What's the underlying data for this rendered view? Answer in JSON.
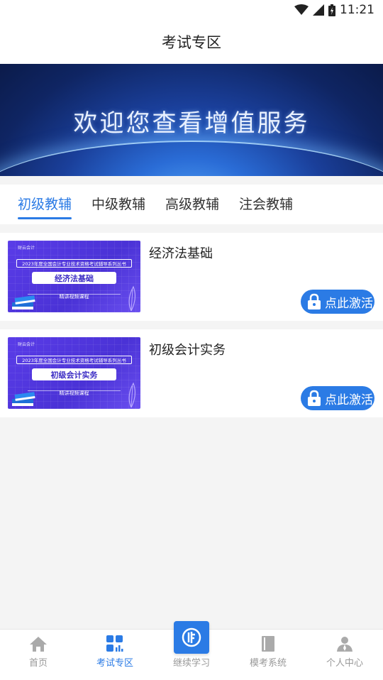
{
  "status": {
    "time": "11:21"
  },
  "header": {
    "title": "考试专区"
  },
  "banner": {
    "text": "欢迎您查看增值服务"
  },
  "tabs": [
    {
      "label": "初级教辅",
      "active": true
    },
    {
      "label": "中级教辅",
      "active": false
    },
    {
      "label": "高级教辅",
      "active": false
    },
    {
      "label": "注会教辅",
      "active": false
    }
  ],
  "courses": [
    {
      "name": "经济法基础",
      "thumb_brand": "财云会计",
      "thumb_series": "2023年度全国会计专业技术资格考试辅导系列丛书",
      "thumb_title": "经济法基础",
      "thumb_sub": "精讲视频课程",
      "button": "点此激活"
    },
    {
      "name": "初级会计实务",
      "thumb_brand": "财云会计",
      "thumb_series": "2023年度全国会计专业技术资格考试辅导系列丛书",
      "thumb_title": "初级会计实务",
      "thumb_sub": "精讲视频课程",
      "button": "点此激活"
    }
  ],
  "nav": [
    {
      "label": "首页",
      "icon": "home-icon"
    },
    {
      "label": "考试专区",
      "icon": "grid-chart-icon",
      "active": true
    },
    {
      "label": "继续学习",
      "icon": "continue-study-icon"
    },
    {
      "label": "模考系统",
      "icon": "book-icon"
    },
    {
      "label": "个人中心",
      "icon": "person-icon"
    }
  ],
  "colors": {
    "accent": "#2b7be5",
    "thumb_bg": "#5a3ce8"
  }
}
